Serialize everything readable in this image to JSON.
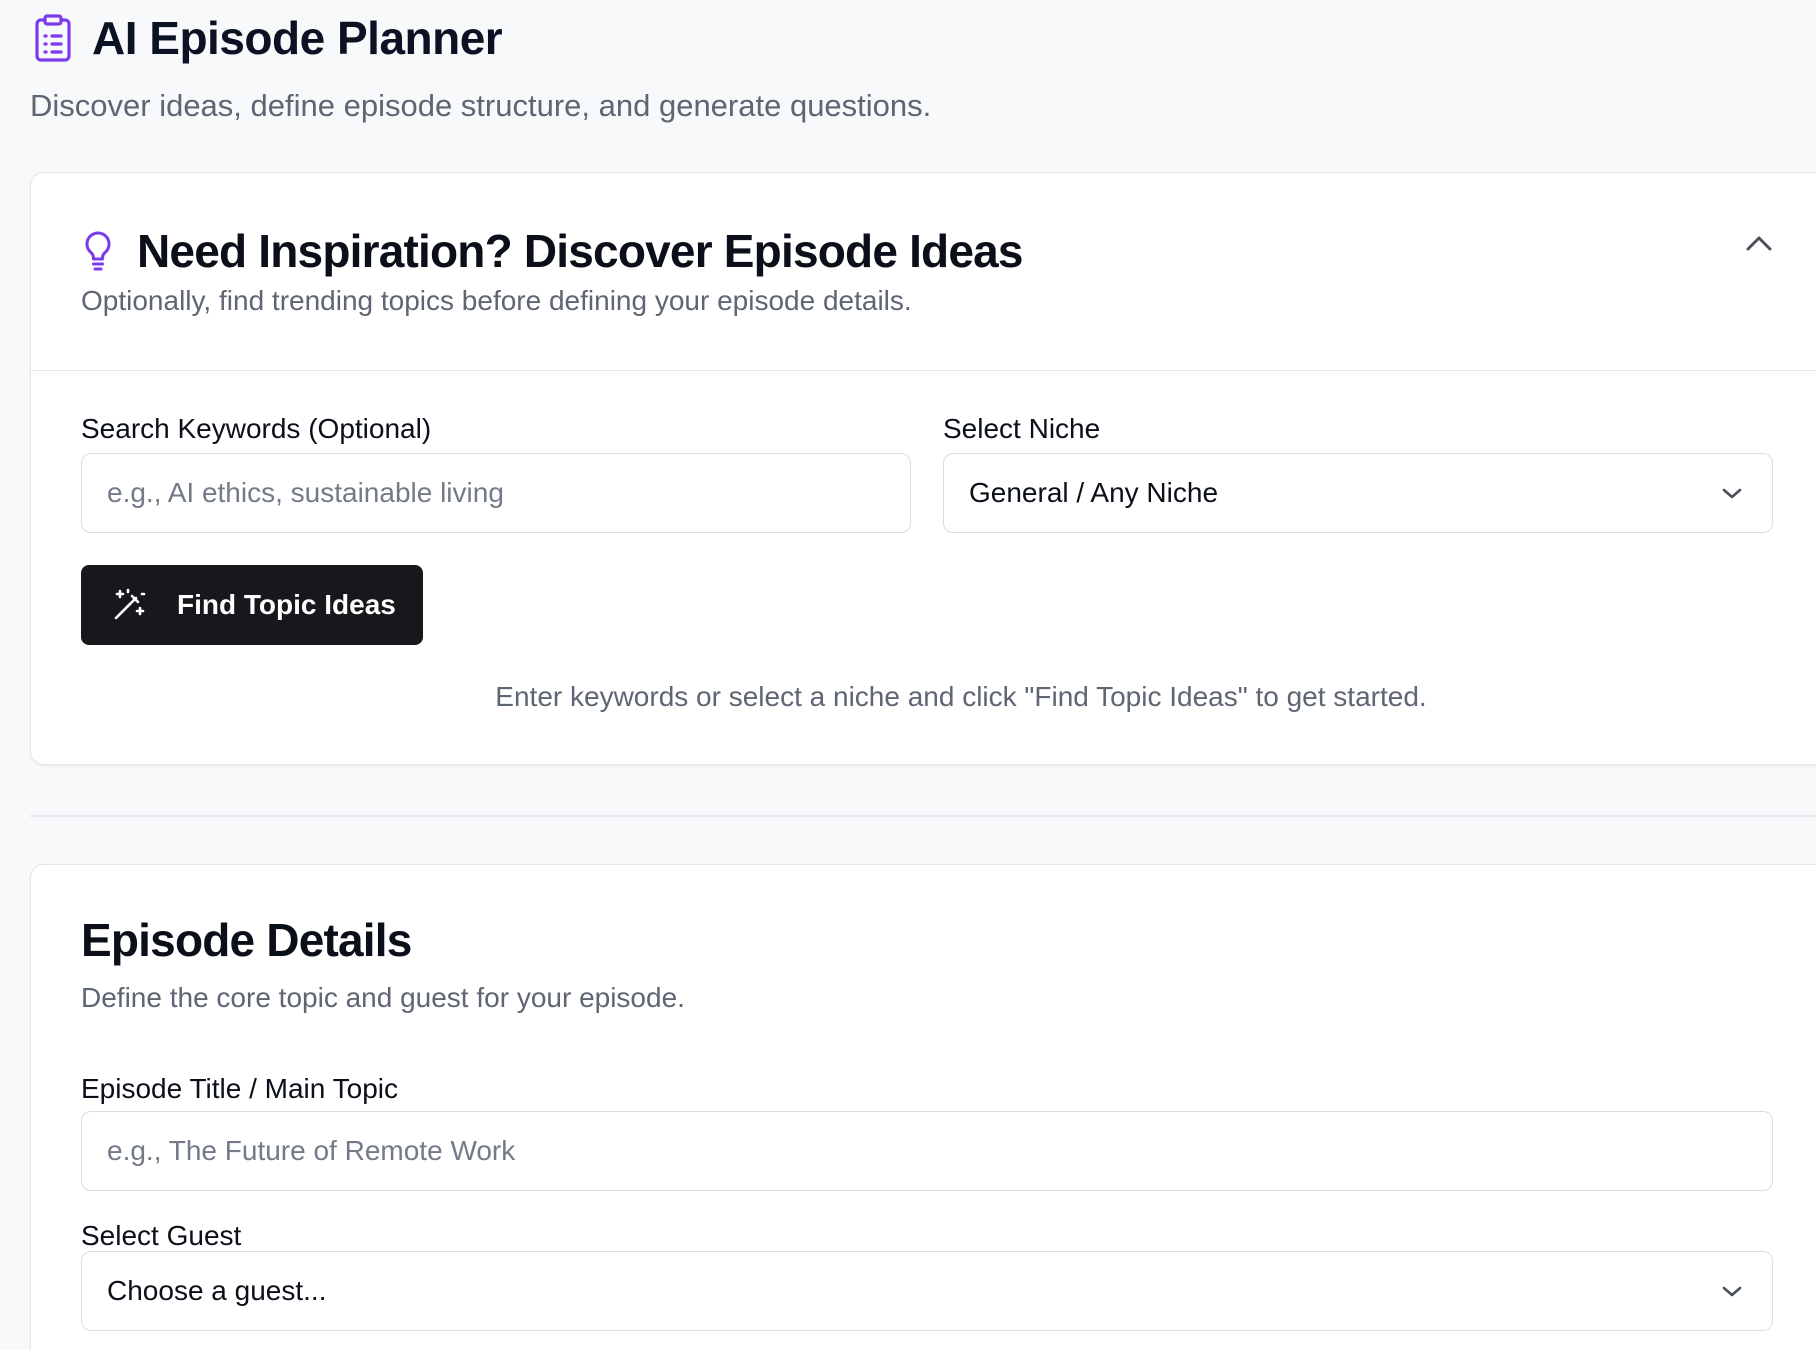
{
  "header": {
    "title": "AI Episode Planner",
    "subtitle": "Discover ideas, define episode structure, and generate questions.",
    "icon": "clipboard-list-icon"
  },
  "inspiration": {
    "icon": "lightbulb-icon",
    "title": "Need Inspiration? Discover Episode Ideas",
    "subtitle": "Optionally, find trending topics before defining your episode details.",
    "collapse_icon": "chevron-up-icon",
    "keywords": {
      "label": "Search Keywords (Optional)",
      "value": "",
      "placeholder": "e.g., AI ethics, sustainable living"
    },
    "niche": {
      "label": "Select Niche",
      "selected": "General / Any Niche"
    },
    "find_button": {
      "icon": "magic-wand-icon",
      "label": "Find Topic Ideas"
    },
    "hint": "Enter keywords or select a niche and click \"Find Topic Ideas\" to get started."
  },
  "details": {
    "title": "Episode Details",
    "subtitle": "Define the core topic and guest for your episode.",
    "episode_title": {
      "label": "Episode Title / Main Topic",
      "value": "",
      "placeholder": "e.g., The Future of Remote Work"
    },
    "guest": {
      "label": "Select Guest",
      "selected": "Choose a guest..."
    }
  },
  "colors": {
    "accent": "#7c3aed",
    "background": "#f8f9fb",
    "button": "#17181c",
    "muted_text": "#5e6673"
  }
}
